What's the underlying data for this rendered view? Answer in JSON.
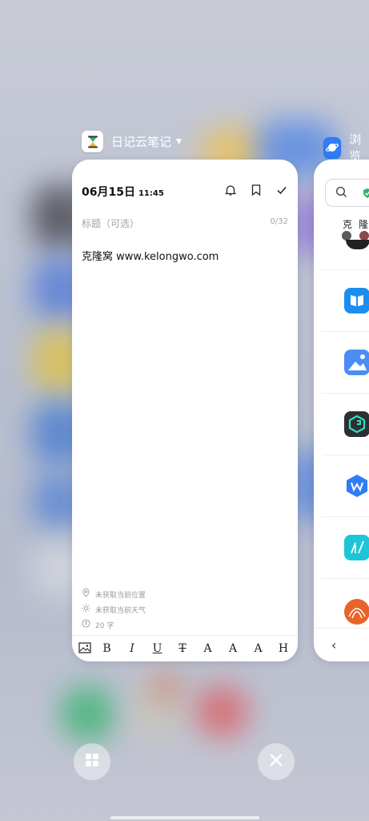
{
  "recents": {
    "main_app": {
      "name": "日记云笔记",
      "icon": "hourglass-icon"
    },
    "side_app": {
      "name": "浏览",
      "icon": "browser-planet-icon"
    }
  },
  "note": {
    "date": "06月15日",
    "time": "11:45",
    "title_placeholder": "标题（可选）",
    "title_count": "0/32",
    "body": "克隆窝 www.kelongwo.com",
    "meta": {
      "location": "未获取当前位置",
      "weather": "未获取当前天气",
      "word_count": "20 字"
    },
    "toolbar": [
      "B",
      "I",
      "U",
      "T",
      "A",
      "A",
      "A",
      "H"
    ]
  },
  "side_card": {
    "chars": [
      "克",
      "隆"
    ],
    "back_label": "‹"
  },
  "colors": {
    "accent_blue": "#2f7cf6",
    "green": "#2fb36c"
  }
}
